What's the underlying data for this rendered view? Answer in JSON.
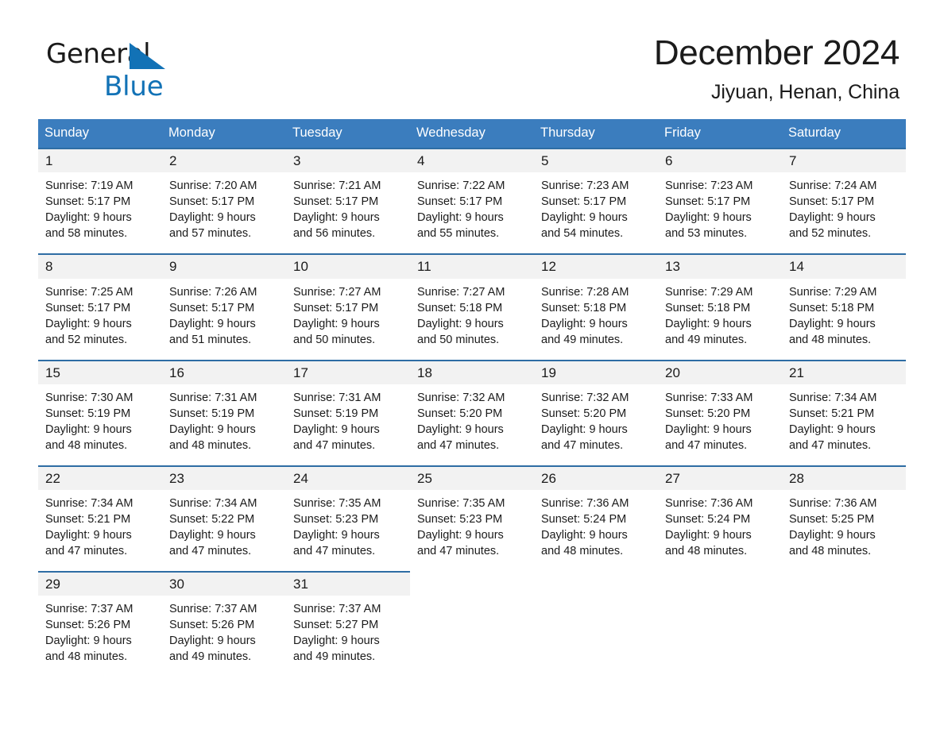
{
  "brand": {
    "name_top": "General",
    "name_bottom": "Blue",
    "flag_icon": "triangle-flag-icon",
    "accent_color": "#1272b6"
  },
  "header": {
    "month_title": "December 2024",
    "location": "Jiyuan, Henan, China"
  },
  "calendar": {
    "header_bg": "#3b7dbe",
    "date_band_bg": "#f2f2f2",
    "rule_color": "#2e6da4",
    "day_names": [
      "Sunday",
      "Monday",
      "Tuesday",
      "Wednesday",
      "Thursday",
      "Friday",
      "Saturday"
    ],
    "weeks": [
      {
        "dates": [
          "1",
          "2",
          "3",
          "4",
          "5",
          "6",
          "7"
        ],
        "cells": [
          {
            "sunrise": "Sunrise: 7:19 AM",
            "sunset": "Sunset: 5:17 PM",
            "daylight_1": "Daylight: 9 hours",
            "daylight_2": "and 58 minutes."
          },
          {
            "sunrise": "Sunrise: 7:20 AM",
            "sunset": "Sunset: 5:17 PM",
            "daylight_1": "Daylight: 9 hours",
            "daylight_2": "and 57 minutes."
          },
          {
            "sunrise": "Sunrise: 7:21 AM",
            "sunset": "Sunset: 5:17 PM",
            "daylight_1": "Daylight: 9 hours",
            "daylight_2": "and 56 minutes."
          },
          {
            "sunrise": "Sunrise: 7:22 AM",
            "sunset": "Sunset: 5:17 PM",
            "daylight_1": "Daylight: 9 hours",
            "daylight_2": "and 55 minutes."
          },
          {
            "sunrise": "Sunrise: 7:23 AM",
            "sunset": "Sunset: 5:17 PM",
            "daylight_1": "Daylight: 9 hours",
            "daylight_2": "and 54 minutes."
          },
          {
            "sunrise": "Sunrise: 7:23 AM",
            "sunset": "Sunset: 5:17 PM",
            "daylight_1": "Daylight: 9 hours",
            "daylight_2": "and 53 minutes."
          },
          {
            "sunrise": "Sunrise: 7:24 AM",
            "sunset": "Sunset: 5:17 PM",
            "daylight_1": "Daylight: 9 hours",
            "daylight_2": "and 52 minutes."
          }
        ]
      },
      {
        "dates": [
          "8",
          "9",
          "10",
          "11",
          "12",
          "13",
          "14"
        ],
        "cells": [
          {
            "sunrise": "Sunrise: 7:25 AM",
            "sunset": "Sunset: 5:17 PM",
            "daylight_1": "Daylight: 9 hours",
            "daylight_2": "and 52 minutes."
          },
          {
            "sunrise": "Sunrise: 7:26 AM",
            "sunset": "Sunset: 5:17 PM",
            "daylight_1": "Daylight: 9 hours",
            "daylight_2": "and 51 minutes."
          },
          {
            "sunrise": "Sunrise: 7:27 AM",
            "sunset": "Sunset: 5:17 PM",
            "daylight_1": "Daylight: 9 hours",
            "daylight_2": "and 50 minutes."
          },
          {
            "sunrise": "Sunrise: 7:27 AM",
            "sunset": "Sunset: 5:18 PM",
            "daylight_1": "Daylight: 9 hours",
            "daylight_2": "and 50 minutes."
          },
          {
            "sunrise": "Sunrise: 7:28 AM",
            "sunset": "Sunset: 5:18 PM",
            "daylight_1": "Daylight: 9 hours",
            "daylight_2": "and 49 minutes."
          },
          {
            "sunrise": "Sunrise: 7:29 AM",
            "sunset": "Sunset: 5:18 PM",
            "daylight_1": "Daylight: 9 hours",
            "daylight_2": "and 49 minutes."
          },
          {
            "sunrise": "Sunrise: 7:29 AM",
            "sunset": "Sunset: 5:18 PM",
            "daylight_1": "Daylight: 9 hours",
            "daylight_2": "and 48 minutes."
          }
        ]
      },
      {
        "dates": [
          "15",
          "16",
          "17",
          "18",
          "19",
          "20",
          "21"
        ],
        "cells": [
          {
            "sunrise": "Sunrise: 7:30 AM",
            "sunset": "Sunset: 5:19 PM",
            "daylight_1": "Daylight: 9 hours",
            "daylight_2": "and 48 minutes."
          },
          {
            "sunrise": "Sunrise: 7:31 AM",
            "sunset": "Sunset: 5:19 PM",
            "daylight_1": "Daylight: 9 hours",
            "daylight_2": "and 48 minutes."
          },
          {
            "sunrise": "Sunrise: 7:31 AM",
            "sunset": "Sunset: 5:19 PM",
            "daylight_1": "Daylight: 9 hours",
            "daylight_2": "and 47 minutes."
          },
          {
            "sunrise": "Sunrise: 7:32 AM",
            "sunset": "Sunset: 5:20 PM",
            "daylight_1": "Daylight: 9 hours",
            "daylight_2": "and 47 minutes."
          },
          {
            "sunrise": "Sunrise: 7:32 AM",
            "sunset": "Sunset: 5:20 PM",
            "daylight_1": "Daylight: 9 hours",
            "daylight_2": "and 47 minutes."
          },
          {
            "sunrise": "Sunrise: 7:33 AM",
            "sunset": "Sunset: 5:20 PM",
            "daylight_1": "Daylight: 9 hours",
            "daylight_2": "and 47 minutes."
          },
          {
            "sunrise": "Sunrise: 7:34 AM",
            "sunset": "Sunset: 5:21 PM",
            "daylight_1": "Daylight: 9 hours",
            "daylight_2": "and 47 minutes."
          }
        ]
      },
      {
        "dates": [
          "22",
          "23",
          "24",
          "25",
          "26",
          "27",
          "28"
        ],
        "cells": [
          {
            "sunrise": "Sunrise: 7:34 AM",
            "sunset": "Sunset: 5:21 PM",
            "daylight_1": "Daylight: 9 hours",
            "daylight_2": "and 47 minutes."
          },
          {
            "sunrise": "Sunrise: 7:34 AM",
            "sunset": "Sunset: 5:22 PM",
            "daylight_1": "Daylight: 9 hours",
            "daylight_2": "and 47 minutes."
          },
          {
            "sunrise": "Sunrise: 7:35 AM",
            "sunset": "Sunset: 5:23 PM",
            "daylight_1": "Daylight: 9 hours",
            "daylight_2": "and 47 minutes."
          },
          {
            "sunrise": "Sunrise: 7:35 AM",
            "sunset": "Sunset: 5:23 PM",
            "daylight_1": "Daylight: 9 hours",
            "daylight_2": "and 47 minutes."
          },
          {
            "sunrise": "Sunrise: 7:36 AM",
            "sunset": "Sunset: 5:24 PM",
            "daylight_1": "Daylight: 9 hours",
            "daylight_2": "and 48 minutes."
          },
          {
            "sunrise": "Sunrise: 7:36 AM",
            "sunset": "Sunset: 5:24 PM",
            "daylight_1": "Daylight: 9 hours",
            "daylight_2": "and 48 minutes."
          },
          {
            "sunrise": "Sunrise: 7:36 AM",
            "sunset": "Sunset: 5:25 PM",
            "daylight_1": "Daylight: 9 hours",
            "daylight_2": "and 48 minutes."
          }
        ]
      },
      {
        "dates": [
          "29",
          "30",
          "31",
          "",
          "",
          "",
          ""
        ],
        "cells": [
          {
            "sunrise": "Sunrise: 7:37 AM",
            "sunset": "Sunset: 5:26 PM",
            "daylight_1": "Daylight: 9 hours",
            "daylight_2": "and 48 minutes."
          },
          {
            "sunrise": "Sunrise: 7:37 AM",
            "sunset": "Sunset: 5:26 PM",
            "daylight_1": "Daylight: 9 hours",
            "daylight_2": "and 49 minutes."
          },
          {
            "sunrise": "Sunrise: 7:37 AM",
            "sunset": "Sunset: 5:27 PM",
            "daylight_1": "Daylight: 9 hours",
            "daylight_2": "and 49 minutes."
          },
          {
            "sunrise": "",
            "sunset": "",
            "daylight_1": "",
            "daylight_2": ""
          },
          {
            "sunrise": "",
            "sunset": "",
            "daylight_1": "",
            "daylight_2": ""
          },
          {
            "sunrise": "",
            "sunset": "",
            "daylight_1": "",
            "daylight_2": ""
          },
          {
            "sunrise": "",
            "sunset": "",
            "daylight_1": "",
            "daylight_2": ""
          }
        ]
      }
    ]
  }
}
